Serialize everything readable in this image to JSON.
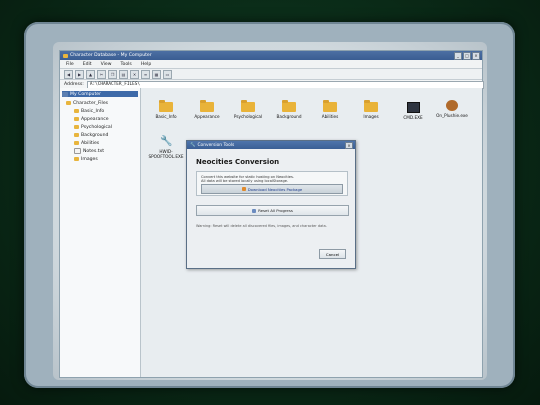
{
  "window": {
    "title": "Character Database - My Computer",
    "controls": [
      "_",
      "□",
      "×"
    ]
  },
  "menu": [
    "File",
    "Edit",
    "View",
    "Tools",
    "Help"
  ],
  "toolbar": {
    "icons": [
      "back-icon",
      "forward-icon",
      "up-icon",
      "cut-icon",
      "copy-icon",
      "paste-icon",
      "delete-icon",
      "properties-icon",
      "views-icon",
      "folders-icon"
    ]
  },
  "address": {
    "label": "Address:",
    "value": "A:\\CHARACTER_FILES\\"
  },
  "tree": {
    "root": "My Computer",
    "folder": "Character_Files",
    "children": [
      "Basic_Info",
      "Appearance",
      "Psychological",
      "Background",
      "Abilities",
      "Notes.txt",
      "Images"
    ]
  },
  "files": [
    {
      "label": "Basic_Info",
      "icon": "folder-icon"
    },
    {
      "label": "Appearance",
      "icon": "folder-icon"
    },
    {
      "label": "Psychological",
      "icon": "folder-icon"
    },
    {
      "label": "Background",
      "icon": "folder-icon"
    },
    {
      "label": "Abilities",
      "icon": "folder-icon"
    },
    {
      "label": "Images",
      "icon": "folder-icon"
    },
    {
      "label": "CMD.EXE",
      "icon": "terminal-icon"
    },
    {
      "label": "On_Plushie.exe",
      "icon": "bear-icon"
    },
    {
      "label": "HWID-SPOOFTOOL.EXE",
      "icon": "wrench-icon"
    }
  ],
  "dialog": {
    "title": "Conversion Tools",
    "close": "×",
    "heading": "Neocities Conversion",
    "desc_line1": "Convert this website for static hosting on Neocities.",
    "desc_line2": "All data will be stored locally using localStorage.",
    "download_label": "Download Neocities Package",
    "reset_label": "Reset All Progress",
    "warning": "Warning: Reset will delete all discovered files, images, and character data.",
    "cancel_label": "Cancel"
  }
}
